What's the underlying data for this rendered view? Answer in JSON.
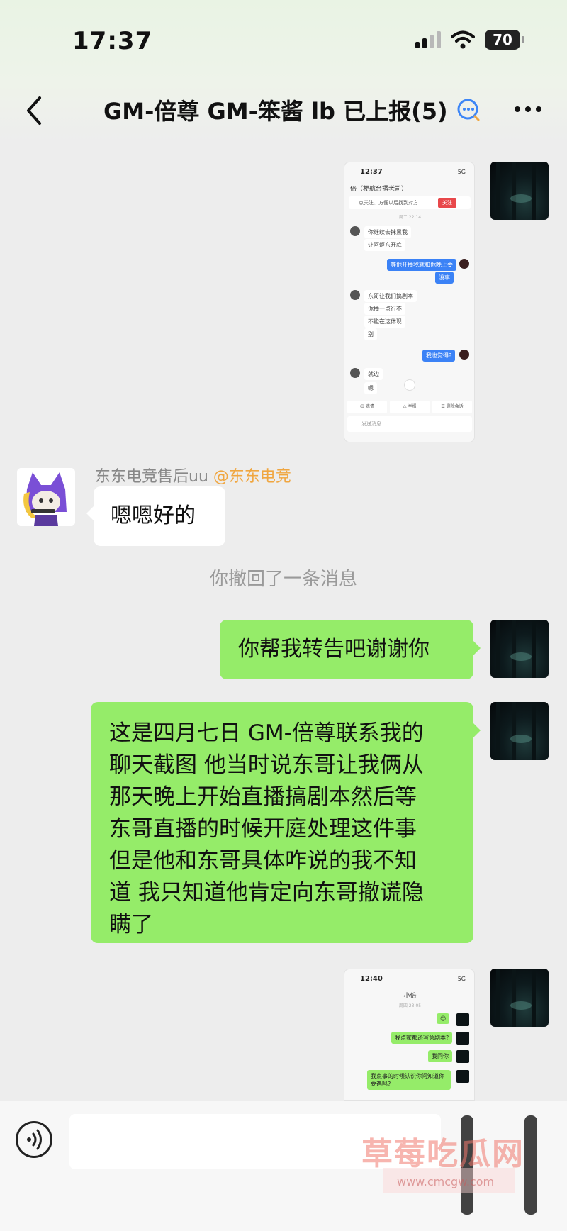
{
  "status": {
    "time": "17:37",
    "battery": "70"
  },
  "nav": {
    "title": "GM-倍尊 GM-笨酱 lb 已上报(5)"
  },
  "messages": {
    "sender_name": "东东电竞售后uu",
    "sender_tag": "@东东电竞",
    "reply": "嗯嗯好的",
    "system": "你撤回了一条消息",
    "forward": "你帮我转告吧谢谢你",
    "long_lines": [
      "这是四月七日 GM-倍尊联系我的",
      "聊天截图 他当时说东哥让我俩从",
      "那天晚上开始直播搞剧本然后等",
      "东哥直播的时候开庭处理这件事",
      "但是他和东哥具体咋说的我不知",
      "道 我只知道他肯定向东哥撤谎隐",
      "瞒了"
    ]
  },
  "thumb1": {
    "time": "12:37",
    "status": "5G",
    "title": "倍（梗航台播老司）",
    "notice": "点关注、方便以后找到对方",
    "notice_button": "关注",
    "date": "周二 22:14",
    "lines": [
      "你继续去抹黑我",
      "让阿炬东开庭"
    ],
    "blue1": "等他开播我就和你晚上要",
    "blue1b": "没事",
    "lines2": [
      "东哥让我们搞剧本",
      "你播一点行不",
      "不能在这体现",
      "别"
    ],
    "blue2": "我也觉得?",
    "lines3": [
      "就边",
      "嗯"
    ],
    "tabs": [
      "☺ 表情",
      "⚠ 举报",
      "☰ 删除会话"
    ],
    "input_placeholder": "发送消息"
  },
  "thumb2": {
    "time": "12:40",
    "status": "5G",
    "title": "小倍",
    "date": "周四 23:05",
    "msgs": [
      "😊",
      "我点家都还写意剧本?",
      "我问你",
      "我点事的时候认识你问知道你要遇吗?"
    ]
  },
  "watermark": {
    "text": "草莓吃瓜网",
    "url": "www.cmcgw.com"
  }
}
